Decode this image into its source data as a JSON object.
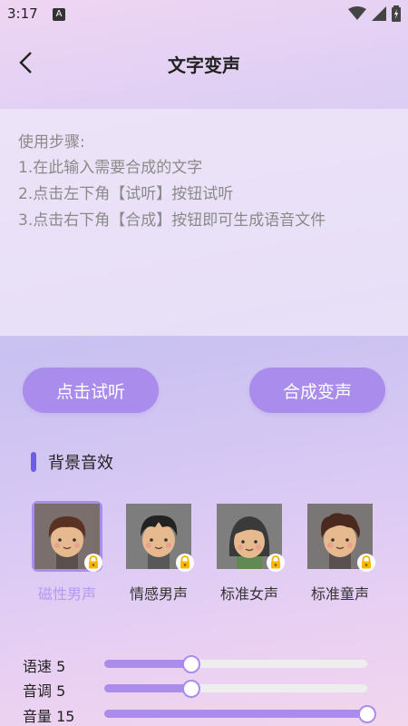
{
  "status_bar": {
    "time": "3:17",
    "badge": "A"
  },
  "header": {
    "title": "文字变声"
  },
  "instructions": {
    "heading": "使用步骤:",
    "steps": [
      " 1.在此输入需要合成的文字",
      " 2.点击左下角【试听】按钮试听",
      " 3.点击右下角【合成】按钮即可生成语音文件"
    ]
  },
  "buttons": {
    "listen": "点击试听",
    "synthesize": "合成变声"
  },
  "section": {
    "title": "背景音效"
  },
  "voices": [
    {
      "label": "磁性男声",
      "selected": true,
      "locked": true,
      "icon": "male-avatar-icon"
    },
    {
      "label": "情感男声",
      "selected": false,
      "locked": true,
      "icon": "male-avatar-icon"
    },
    {
      "label": "标准女声",
      "selected": false,
      "locked": true,
      "icon": "female-avatar-icon"
    },
    {
      "label": "标准童声",
      "selected": false,
      "locked": true,
      "icon": "child-avatar-icon"
    }
  ],
  "sliders": [
    {
      "label": "语速 5",
      "fraction": 0.33
    },
    {
      "label": "音调 5",
      "fraction": 0.33
    },
    {
      "label": "音量 15",
      "fraction": 1.0
    }
  ],
  "colors": {
    "accent": "#a98ceb",
    "section_bar": "#6e5ee6",
    "selected_label": "#b29af0"
  }
}
